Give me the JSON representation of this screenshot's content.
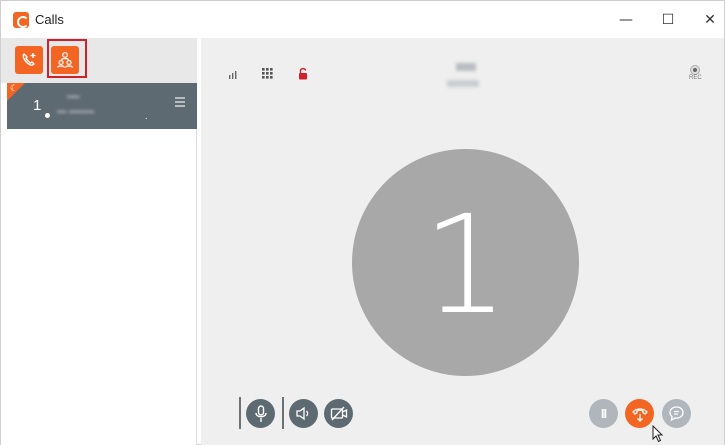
{
  "window": {
    "title": "Calls",
    "controls": {
      "minimize": "—",
      "maximize": "☐",
      "close": "✕"
    }
  },
  "toolbar": {
    "buttons": [
      {
        "name": "new-call",
        "icon": "phone-plus-icon"
      },
      {
        "name": "conference",
        "icon": "conference-icon",
        "highlighted": true
      }
    ]
  },
  "calls": [
    {
      "number": "1",
      "name": "••••",
      "detail": "••• ••••••••",
      "ellipsis": ".",
      "status_icon": "moon-icon",
      "menu_icon": "hamburger-menu-icon"
    }
  ],
  "call_view": {
    "peer_name": "••••",
    "peer_sub": "••• ••",
    "avatar_label": "1",
    "rec_label": "REC",
    "avatar_color": "#a8a8a8"
  },
  "controls": [
    {
      "name": "microphone",
      "icon": "microphone-icon"
    },
    {
      "name": "speaker",
      "icon": "speaker-icon"
    },
    {
      "name": "video-off",
      "icon": "video-off-icon"
    },
    {
      "name": "hold",
      "icon": "pause-icon",
      "glyph": "II"
    },
    {
      "name": "transfer",
      "icon": "phone-transfer-icon"
    },
    {
      "name": "chat",
      "icon": "chat-icon"
    }
  ],
  "colors": {
    "accent": "#f26522",
    "dark": "#5e6a72",
    "highlight": "#d0202a",
    "background": "#efefef"
  }
}
